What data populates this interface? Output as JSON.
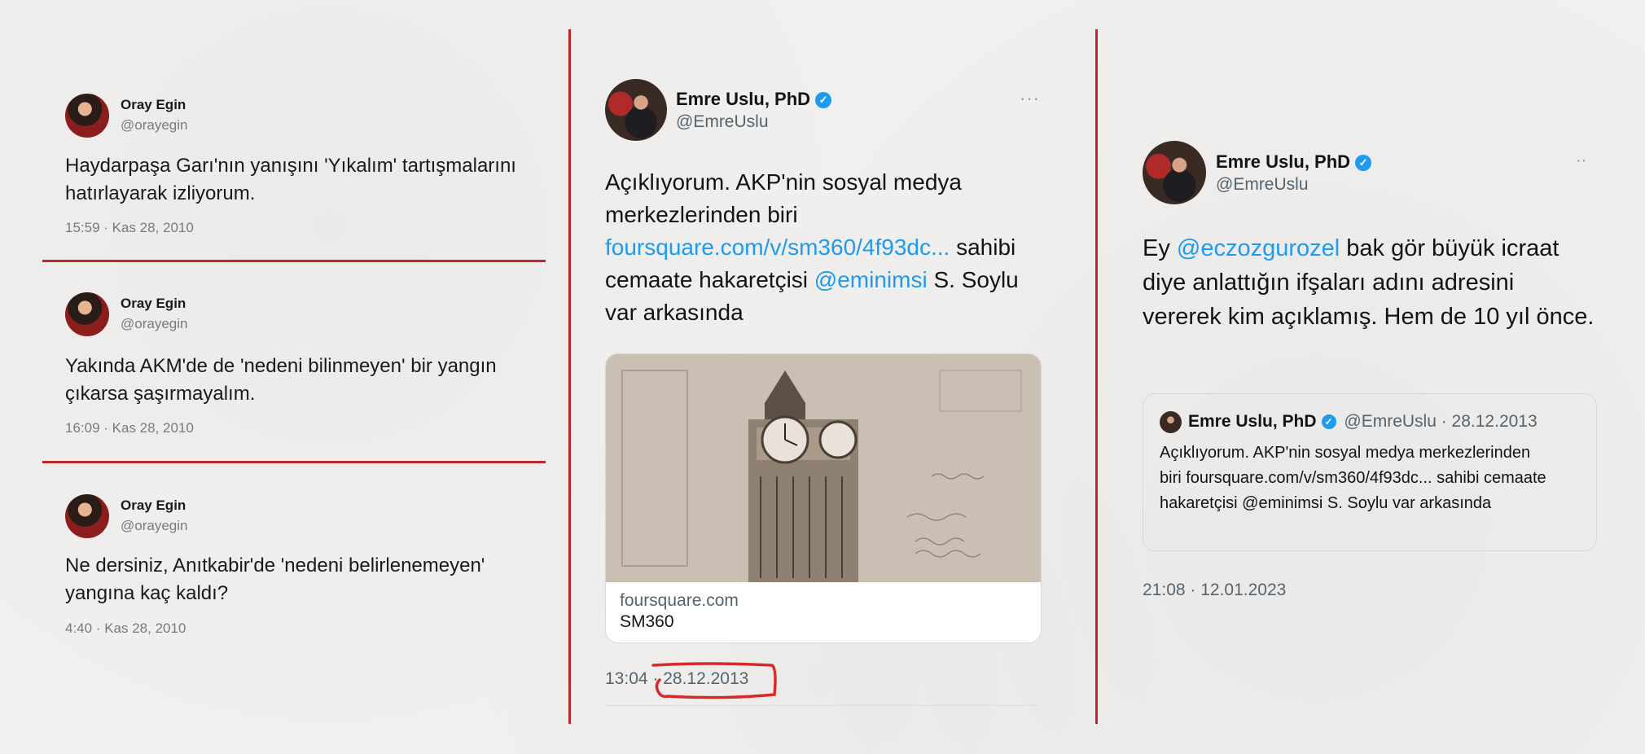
{
  "left_tweets": [
    {
      "name": "Oray Egin",
      "handle": "@orayegin",
      "text": "Haydarpaşa Garı'nın yanışını 'Yıkalım' tartışmalarını hatırlayarak izliyorum.",
      "meta": "15:59 · Kas 28, 2010"
    },
    {
      "name": "Oray Egin",
      "handle": "@orayegin",
      "text": "Yakında AKM'de de 'nedeni bilinmeyen' bir yangın çıkarsa şaşırmayalım.",
      "meta": "16:09 · Kas 28, 2010"
    },
    {
      "name": "Oray Egin",
      "handle": "@orayegin",
      "text": "Ne dersiniz, Anıtkabir'de 'nedeni belirlenemeyen' yangına kaç kaldı?",
      "meta": "4:40 · Kas 28, 2010"
    }
  ],
  "middle_tweet": {
    "name": "Emre Uslu, PhD",
    "handle": "@EmreUslu",
    "more": "···",
    "text_part1": "Açıklıyorum. AKP'nin sosyal medya merkezlerinden biri ",
    "link1": "foursquare.com/v/sm360/4f93dc...",
    "text_part2": " sahibi cemaate hakaretçisi ",
    "mention": "@eminimsi",
    "text_part3": " S. Soylu var arkasında",
    "card_domain": "foursquare.com",
    "card_title": "SM360",
    "time": "13:04 · ",
    "date": "28.12.2013"
  },
  "right_tweet": {
    "name": "Emre Uslu, PhD",
    "handle": "@EmreUslu",
    "more": "··",
    "text_part1": "Ey ",
    "mention": "@eczozgurozel",
    "text_part2": " bak gör büyük icraat diye anlattığın ifşaları adını adresini vererek kim açıklamış. Hem de 10 yıl önce.",
    "quote": {
      "name": "Emre Uslu, PhD",
      "handle_date": "@EmreUslu · 28.12.2013",
      "text": "Açıklıyorum. AKP'nin sosyal medya merkezlerinden biri foursquare.com/v/sm360/4f93dc... sahibi cemaate hakaretçisi @eminimsi S. Soylu var arkasında"
    },
    "meta": "21:08 · 12.01.2023"
  },
  "colors": {
    "divider": "#c0272d",
    "link": "#1d9bf0",
    "verified": "#1d9bf0",
    "highlight": "#d42a2a"
  }
}
